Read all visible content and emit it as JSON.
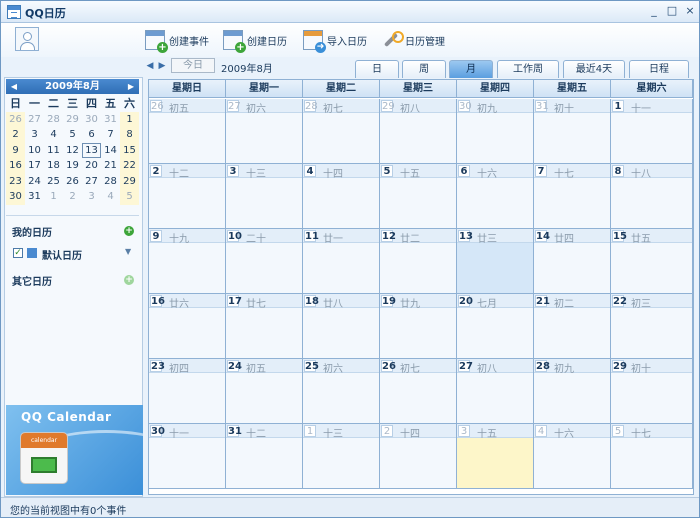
{
  "window": {
    "title": "QQ日历",
    "minimize": "_",
    "maximize": "□",
    "close": "×"
  },
  "toolbar": {
    "create_event": "创建事件",
    "create_calendar": "创建日历",
    "import_calendar": "导入日历",
    "manage_calendar": "日历管理"
  },
  "nav": {
    "today": "今日",
    "current_month": "2009年8月",
    "prev": "◀",
    "next": "▶"
  },
  "tabs": [
    {
      "label": "日",
      "active": false
    },
    {
      "label": "周",
      "active": false
    },
    {
      "label": "月",
      "active": true
    },
    {
      "label": "工作周",
      "active": false
    },
    {
      "label": "最近4天",
      "active": false
    },
    {
      "label": "日程",
      "active": false
    }
  ],
  "mini_calendar": {
    "title": "2009年8月",
    "weekdays": [
      "日",
      "一",
      "二",
      "三",
      "四",
      "五",
      "六"
    ],
    "weeks": [
      [
        "26",
        "27",
        "28",
        "29",
        "30",
        "31",
        "1"
      ],
      [
        "2",
        "3",
        "4",
        "5",
        "6",
        "7",
        "8"
      ],
      [
        "9",
        "10",
        "11",
        "12",
        "13",
        "14",
        "15"
      ],
      [
        "16",
        "17",
        "18",
        "19",
        "20",
        "21",
        "22"
      ],
      [
        "23",
        "24",
        "25",
        "26",
        "27",
        "28",
        "29"
      ],
      [
        "30",
        "31",
        "1",
        "2",
        "3",
        "4",
        "5"
      ]
    ]
  },
  "sidebar": {
    "my_calendars": "我的日历",
    "default_calendar": "默认日历",
    "other_calendars": "其它日历",
    "checked": "✓",
    "dropdown": "▼",
    "plus": "+"
  },
  "promo": {
    "text": "QQ Calendar",
    "cal_label": "calendar"
  },
  "status": "您的当前视图中有0个事件",
  "colors": {
    "accent": "#4a8ad0",
    "today_cell": "#d5e7f8",
    "highlight_cell": "#fdf6c9"
  },
  "month_view": {
    "weekdays": [
      "星期日",
      "星期一",
      "星期二",
      "星期三",
      "星期四",
      "星期五",
      "星期六"
    ],
    "weeks": [
      [
        {
          "d": "26",
          "l": "初五",
          "o": true
        },
        {
          "d": "27",
          "l": "初六",
          "o": true
        },
        {
          "d": "28",
          "l": "初七",
          "o": true
        },
        {
          "d": "29",
          "l": "初八",
          "o": true
        },
        {
          "d": "30",
          "l": "初九",
          "o": true
        },
        {
          "d": "31",
          "l": "初十",
          "o": true
        },
        {
          "d": "1",
          "l": "十一"
        }
      ],
      [
        {
          "d": "2",
          "l": "十二"
        },
        {
          "d": "3",
          "l": "十三"
        },
        {
          "d": "4",
          "l": "十四"
        },
        {
          "d": "5",
          "l": "十五"
        },
        {
          "d": "6",
          "l": "十六"
        },
        {
          "d": "7",
          "l": "十七"
        },
        {
          "d": "8",
          "l": "十八"
        }
      ],
      [
        {
          "d": "9",
          "l": "十九"
        },
        {
          "d": "10",
          "l": "二十"
        },
        {
          "d": "11",
          "l": "廿一"
        },
        {
          "d": "12",
          "l": "廿二"
        },
        {
          "d": "13",
          "l": "廿三",
          "today": true
        },
        {
          "d": "14",
          "l": "廿四"
        },
        {
          "d": "15",
          "l": "廿五"
        }
      ],
      [
        {
          "d": "16",
          "l": "廿六"
        },
        {
          "d": "17",
          "l": "廿七"
        },
        {
          "d": "18",
          "l": "廿八"
        },
        {
          "d": "19",
          "l": "廿九"
        },
        {
          "d": "20",
          "l": "七月"
        },
        {
          "d": "21",
          "l": "初二"
        },
        {
          "d": "22",
          "l": "初三"
        }
      ],
      [
        {
          "d": "23",
          "l": "初四"
        },
        {
          "d": "24",
          "l": "初五"
        },
        {
          "d": "25",
          "l": "初六"
        },
        {
          "d": "26",
          "l": "初七"
        },
        {
          "d": "27",
          "l": "初八"
        },
        {
          "d": "28",
          "l": "初九"
        },
        {
          "d": "29",
          "l": "初十"
        }
      ],
      [
        {
          "d": "30",
          "l": "十一"
        },
        {
          "d": "31",
          "l": "十二"
        },
        {
          "d": "1",
          "l": "十三",
          "o": true
        },
        {
          "d": "2",
          "l": "十四",
          "o": true
        },
        {
          "d": "3",
          "l": "十五",
          "o": true,
          "hl": true
        },
        {
          "d": "4",
          "l": "十六",
          "o": true
        },
        {
          "d": "5",
          "l": "十七",
          "o": true
        }
      ]
    ]
  }
}
